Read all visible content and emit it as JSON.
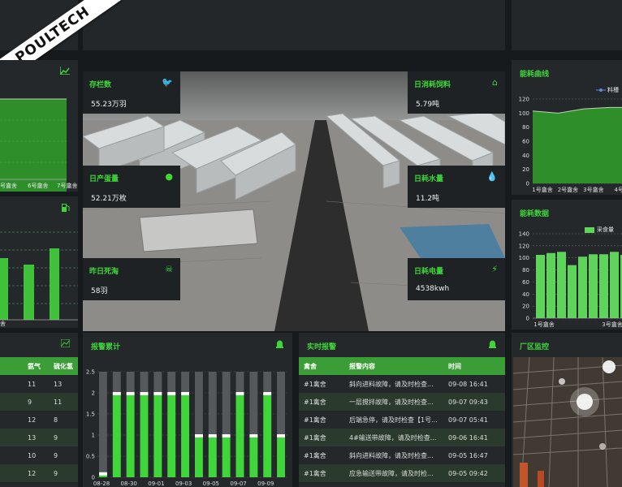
{
  "brand": {
    "logo": "POULTECH"
  },
  "center_cards": [
    {
      "label": "存栏数",
      "value": "55.23万羽",
      "icon": "bird-icon"
    },
    {
      "label": "日消耗饲料",
      "value": "5.79吨",
      "icon": "bank-icon"
    },
    {
      "label": "日产蛋量",
      "value": "52.21万枚",
      "icon": "egg-icon"
    },
    {
      "label": "日耗水量",
      "value": "11.2吨",
      "icon": "water-drop-icon"
    },
    {
      "label": "昨日死淘",
      "value": "58羽",
      "icon": "skull-icon"
    },
    {
      "label": "日耗电量",
      "value": "4538kwh",
      "icon": "lightning-icon"
    }
  ],
  "left_top_chart": {
    "xlabels": [
      "号盦舍",
      "6号盦舍",
      "7号盦舍"
    ]
  },
  "left_mid_chart": {
    "xlabels": [
      "舍",
      "",
      ""
    ]
  },
  "left_table": {
    "headers": [
      "",
      "氨气",
      "硫化氢"
    ],
    "rows": [
      [
        "",
        "11",
        "13"
      ],
      [
        "",
        "9",
        "11"
      ],
      [
        "",
        "12",
        "8"
      ],
      [
        "",
        "13",
        "9"
      ],
      [
        "",
        "10",
        "9"
      ],
      [
        "",
        "12",
        "9"
      ],
      [
        "",
        "",
        ""
      ]
    ]
  },
  "energy_curve": {
    "title": "能耗曲线",
    "legend": "料槽",
    "chart_data": {
      "type": "area",
      "categories": [
        "1号盦舍",
        "2号盦舍",
        "3号盦舍",
        "4号"
      ],
      "values": [
        103,
        100,
        106,
        108
      ],
      "ylim": [
        0,
        120
      ],
      "yticks": [
        0,
        20,
        40,
        60,
        80,
        100,
        120
      ]
    }
  },
  "energy_data": {
    "title": "能耗数据",
    "legend": "采食量",
    "chart_data": {
      "type": "bar",
      "categories": [
        "1号盦舍",
        "",
        "3号盦舍",
        ""
      ],
      "series": [
        {
          "name": "采食量",
          "values": [
            105,
            110,
            102,
            106,
            105,
            104
          ]
        },
        {
          "name": "",
          "values": [
            108,
            88,
            106,
            110,
            100,
            102
          ]
        }
      ],
      "xlabels": [
        "1号盦舍",
        "3号盦舍"
      ],
      "ylim": [
        0,
        140
      ],
      "yticks": [
        0,
        20,
        40,
        60,
        80,
        100,
        120,
        140
      ]
    }
  },
  "alarm_total": {
    "title": "报警累计",
    "chart_data": {
      "type": "bar",
      "categories": [
        "08-28",
        "",
        "08-30",
        "",
        "09-01",
        "",
        "09-03",
        "",
        "09-05",
        "",
        "09-07",
        "",
        "09-09",
        ""
      ],
      "values": [
        0.1,
        2,
        2,
        2,
        2,
        2,
        2,
        1,
        1,
        1,
        2,
        1,
        2,
        1
      ],
      "ylim": [
        0,
        2.5
      ],
      "yticks": [
        0,
        0.5,
        1,
        1.5,
        2,
        2.5
      ],
      "xlabels": [
        "08-28",
        "08-30",
        "09-01",
        "09-03",
        "09-05",
        "09-07",
        "09-09"
      ]
    }
  },
  "realtime_alarm": {
    "title": "实时报警",
    "headers": [
      "禽舍",
      "报警内容",
      "时间"
    ],
    "rows": [
      [
        "#1禽舍",
        "斜向进料故障，请及时检查...",
        "09-08 16:41"
      ],
      [
        "#1禽舍",
        "一层搅拌故障，请及时检查...",
        "09-07 09:43"
      ],
      [
        "#1禽舍",
        "后端急停，请及时检查【1号...",
        "09-07 05:41"
      ],
      [
        "#1禽舍",
        "4#输送带故障，请及时检查...",
        "09-06 16:41"
      ],
      [
        "#1禽舍",
        "斜向进料故障，请及时检查...",
        "09-05 16:47"
      ],
      [
        "#1禽舍",
        "应急输送带故障，请及时检...",
        "09-05 09:42"
      ]
    ]
  },
  "monitor": {
    "title": "厂区监控"
  }
}
